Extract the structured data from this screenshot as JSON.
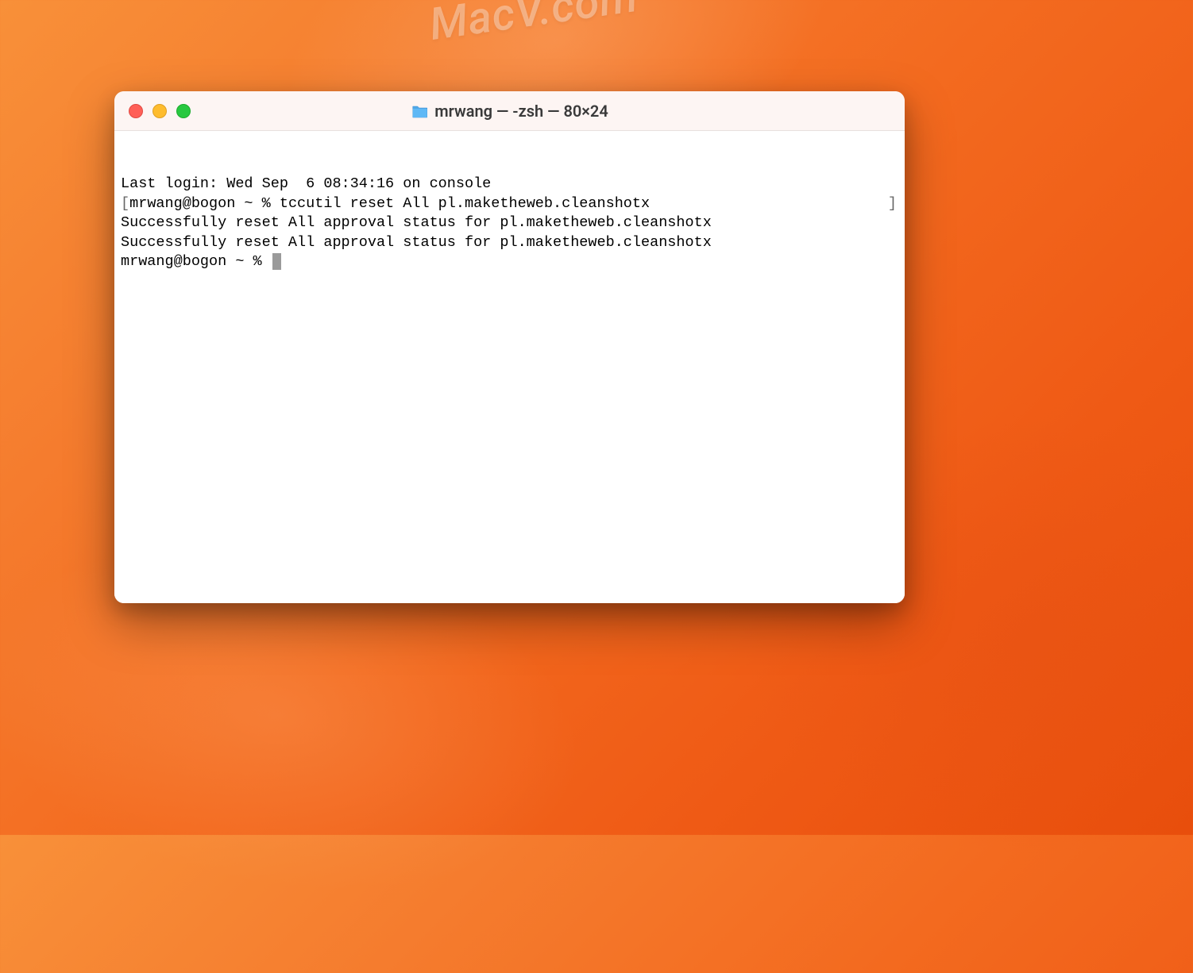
{
  "watermark": "MacV.com",
  "window": {
    "title": "mrwang — -zsh — 80×24"
  },
  "terminal": {
    "lines": [
      "Last login: Wed Sep  6 08:34:16 on console",
      "mrwang@bogon ~ % tccutil reset All pl.maketheweb.cleanshotx",
      "Successfully reset All approval status for pl.maketheweb.cleanshotx",
      "Successfully reset All approval status for pl.maketheweb.cleanshotx",
      "mrwang@bogon ~ % "
    ]
  }
}
